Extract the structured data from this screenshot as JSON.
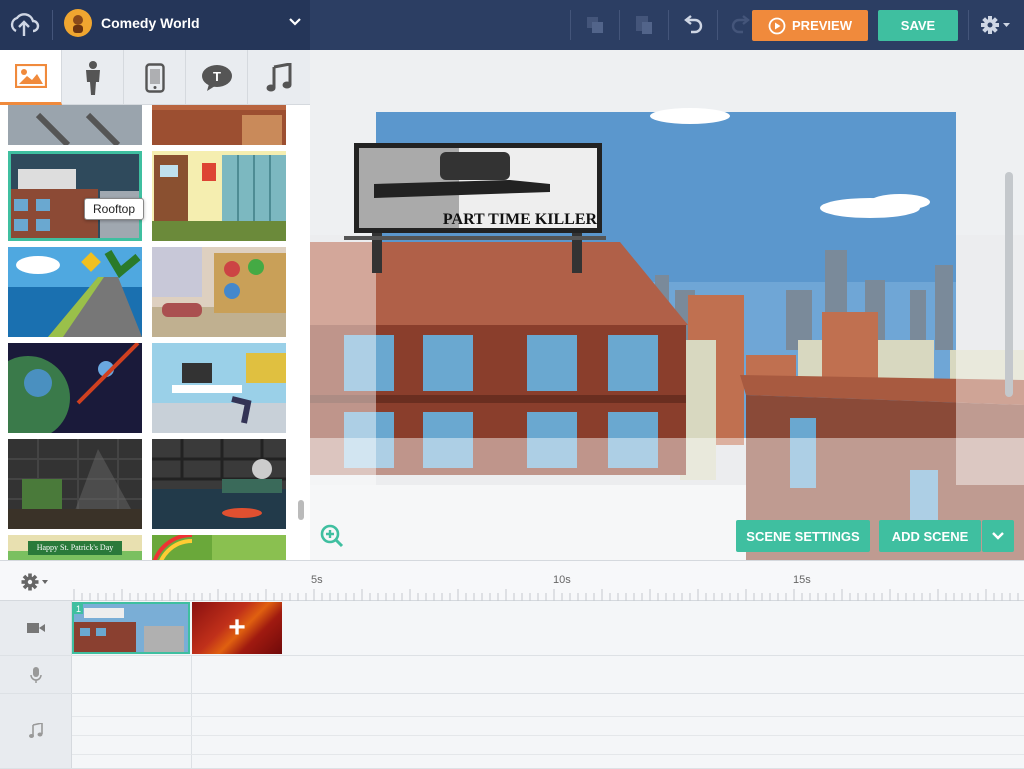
{
  "project": {
    "name": "Comedy World"
  },
  "toolbar": {
    "preview_label": "PREVIEW",
    "save_label": "SAVE"
  },
  "library": {
    "tabs": [
      "backgrounds",
      "characters",
      "devices",
      "text",
      "music"
    ],
    "active_tab": "backgrounds",
    "tooltip": "Rooftop",
    "banner_text": "Happy St. Patrick's Day"
  },
  "stage": {
    "billboard_text": "PART TIME KILLER",
    "scene_settings_label": "SCENE SETTINGS",
    "add_scene_label": "ADD SCENE"
  },
  "timeline": {
    "ticks": [
      "5s",
      "10s",
      "15s"
    ],
    "clip_number": "1",
    "add_clip_label": "+"
  },
  "colors": {
    "accent": "#3fbfa0",
    "preview": "#f08a3c",
    "topbar": "#2c3e63"
  }
}
